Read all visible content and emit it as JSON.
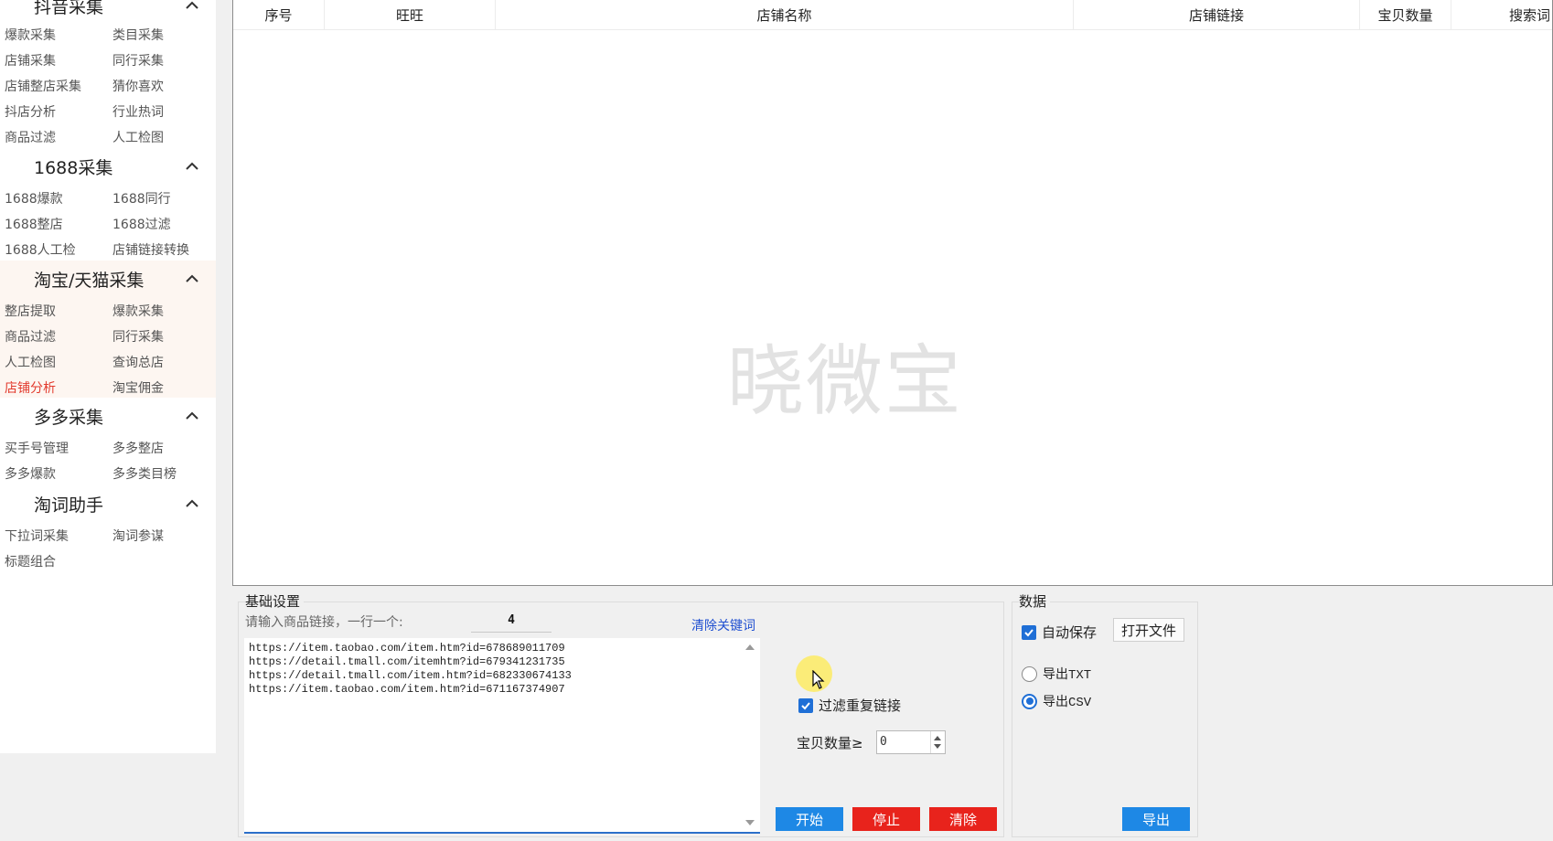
{
  "sidebar": {
    "sections": [
      {
        "title": "抖音采集",
        "items": [
          "爆款采集",
          "类目采集",
          "店铺采集",
          "同行采集",
          "店铺整店采集",
          "猜你喜欢",
          "抖店分析",
          "行业热词",
          "商品过滤",
          "人工检图"
        ]
      },
      {
        "title": "1688采集",
        "items": [
          "1688爆款",
          "1688同行",
          "1688整店",
          "1688过滤",
          "1688人工检",
          "店铺链接转换"
        ]
      },
      {
        "title": "淘宝/天猫采集",
        "items": [
          "整店提取",
          "爆款采集",
          "商品过滤",
          "同行采集",
          "人工检图",
          "查询总店",
          "店铺分析",
          "淘宝佣金"
        ]
      },
      {
        "title": "多多采集",
        "items": [
          "买手号管理",
          "多多整店",
          "多多爆款",
          "多多类目榜"
        ]
      },
      {
        "title": "淘词助手",
        "items": [
          "下拉词采集",
          "淘词参谋",
          "标题组合"
        ]
      }
    ],
    "active_item": "店铺分析"
  },
  "table": {
    "columns": [
      "序号",
      "旺旺",
      "店铺名称",
      "店铺链接",
      "宝贝数量",
      "搜索词"
    ],
    "rows": [],
    "watermark": "晓微宝"
  },
  "basic_settings": {
    "title": "基础设置",
    "input_hint": "请输入商品链接，一行一个:",
    "line_count": "4",
    "clear_keywords": "清除关键词",
    "links": [
      "https://item.taobao.com/item.htm?id=678689011709",
      "https://detail.tmall.com/itemhtm?id=679341231735",
      "https://detail.tmall.com/item.htm?id=682330674133",
      "https://item.taobao.com/item.htm?id=671167374907"
    ],
    "filter_duplicates_label": "过滤重复链接",
    "filter_duplicates_checked": true,
    "item_count_label": "宝贝数量≥",
    "item_count_value": "0",
    "start_label": "开始",
    "stop_label": "停止",
    "clear_label": "清除"
  },
  "data_panel": {
    "title": "数据",
    "auto_save_label": "自动保存",
    "auto_save_checked": true,
    "open_file_label": "打开文件",
    "export_txt_label": "导出TXT",
    "export_csv_label": "导出CSV",
    "selected_format": "CSV",
    "export_label": "导出"
  },
  "colors": {
    "active_sidebar": "#e23b2e",
    "accent_blue": "#1e88e5",
    "danger_red": "#e8231c",
    "section_bg": "#fdf6f1"
  }
}
